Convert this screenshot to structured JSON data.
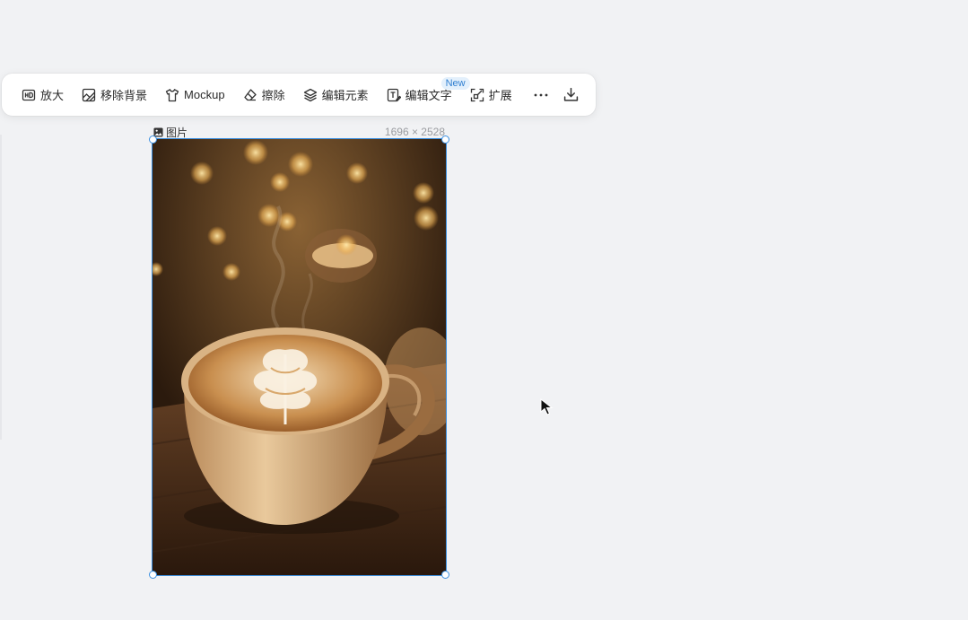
{
  "toolbar": {
    "items": [
      {
        "label": "放大",
        "icon": "hd-icon"
      },
      {
        "label": "移除背景",
        "icon": "remove-background-icon"
      },
      {
        "label": "Mockup",
        "icon": "tshirt-icon"
      },
      {
        "label": "擦除",
        "icon": "eraser-icon"
      },
      {
        "label": "编辑元素",
        "icon": "layers-icon"
      },
      {
        "label": "编辑文字",
        "icon": "edit-text-icon",
        "badge": "New"
      },
      {
        "label": "扩展",
        "icon": "expand-icon"
      }
    ],
    "more_icon": "more-horizontal-icon",
    "download_icon": "download-icon"
  },
  "image": {
    "label": "图片",
    "dimensions": "1696 × 2528",
    "content": "photo of latte art coffee cup"
  },
  "colors": {
    "selection": "#3b8fe0",
    "background": "#f1f2f4",
    "badge_bg": "#e3f0fc",
    "badge_text": "#2f7fd1"
  }
}
